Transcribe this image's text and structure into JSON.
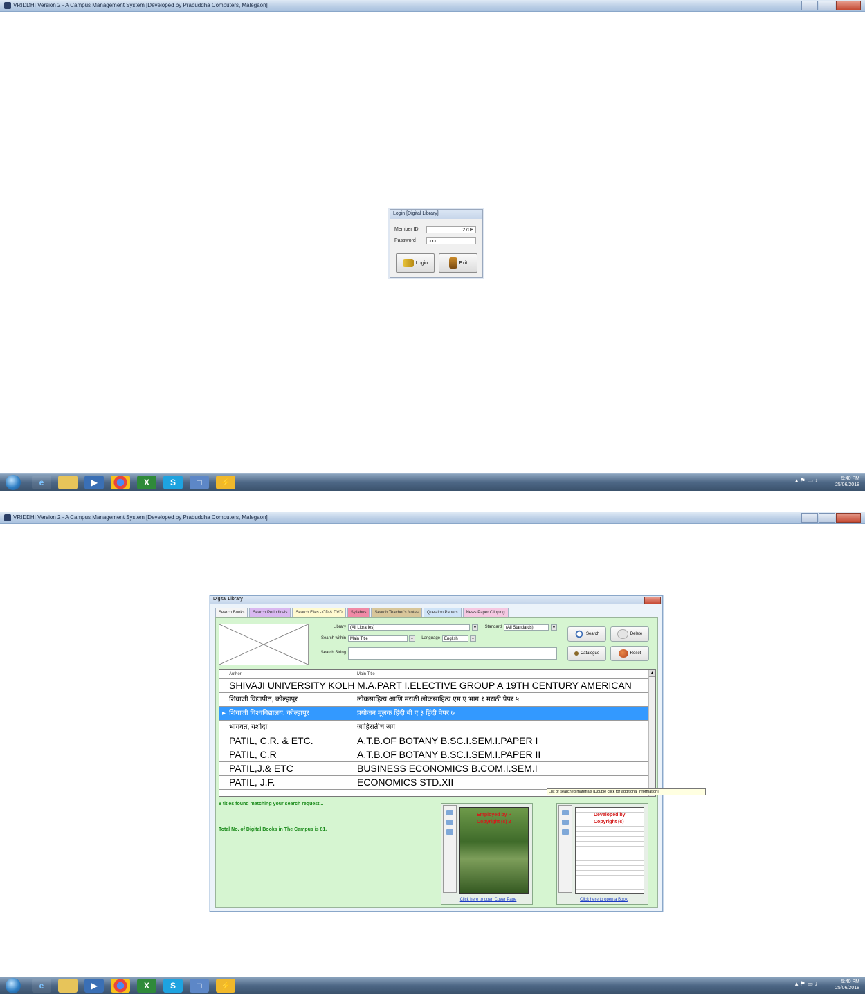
{
  "window_title": "VRIDDHI Version 2 - A Campus Management System [Developed by Prabuddha Computers, Malegaon]",
  "login": {
    "title": "Login [Digital Library]",
    "member_id_label": "Member ID",
    "member_id_value": "2708",
    "password_label": "Password",
    "password_value": "xxx",
    "login_button": "Login",
    "exit_button": "Exit"
  },
  "taskbar": {
    "time": "5:40 PM",
    "date": "25/06/2018"
  },
  "library": {
    "title": "Digital Library",
    "tabs": [
      {
        "label": "Search Books",
        "color": "#f4f4f4"
      },
      {
        "label": "Search Periodicals",
        "color": "#d9b8f0"
      },
      {
        "label": "Search Files - CD & DVD",
        "color": "#fffad0"
      },
      {
        "label": "Syllabus",
        "color": "#f08aa6"
      },
      {
        "label": "Search Teacher's Notes",
        "color": "#d8c69a"
      },
      {
        "label": "Question Papers",
        "color": "#cfe3f7"
      },
      {
        "label": "News Paper Clipping",
        "color": "#f5c8e2"
      }
    ],
    "library_label": "Library",
    "library_value": "(All Libraries)",
    "standard_label": "Standard",
    "standard_value": "(All Standards)",
    "search_within_label": "Search within",
    "search_within_value": "Main Title",
    "language_label": "Language",
    "language_value": "English",
    "search_string_label": "Search String",
    "buttons": {
      "search": "Search",
      "delete": "Delete",
      "catalogue": "Catalogue",
      "reset": "Reset"
    },
    "columns": [
      "Author",
      "Main Title"
    ],
    "rows": [
      {
        "author": "SHIVAJI UNIVERSITY KOLHAPUR",
        "title": "M.A.PART I.ELECTIVE GROUP A 19TH CENTURY AMERICAN",
        "style": "big"
      },
      {
        "author": "शिवाजी विद्यापीठ, कोल्हापूर",
        "title": "लोकसाहित्य आणि मराठी लोकसाहित्य एम ए भाग १ मराठी पेपर ५",
        "style": "dev"
      },
      {
        "author": "शिवाजी विश्वविद्यालय, कोल्हापूर",
        "title": "प्रयोजन मूलक हिंदी बी ए ३ हिंदी पेपर ७",
        "style": "dev",
        "selected": true
      },
      {
        "author": "भागवत, यशोदा",
        "title": "जाहिरातीचे जग",
        "style": "dev"
      },
      {
        "author": "PATIL, C.R. & ETC.",
        "title": "A.T.B.OF BOTANY B.SC.I.SEM.I.PAPER I",
        "style": "big"
      },
      {
        "author": "PATIL, C.R",
        "title": "A.T.B.OF BOTANY B.SC.I.SEM.I.PAPER II",
        "style": "big"
      },
      {
        "author": "PATIL,J.& ETC",
        "title": "BUSINESS ECONOMICS B.COM.I.SEM.I",
        "style": "big"
      },
      {
        "author": "PATIL, J.F.",
        "title": "ECONOMICS STD.XII",
        "style": "big"
      }
    ],
    "found_text": "8 titles found matching your search request...",
    "total_text": "Total No. of Digital Books in The Campus is 81.",
    "cover_watermark_1": "Employed by P",
    "cover_watermark_2": "Copyright (c) 2",
    "cover_link": "Click here to open Cover Page",
    "book_watermark_1": "Developed by",
    "book_watermark_2": "Copyright (c)",
    "book_link": "Click here to open a Book",
    "tooltip": "List of searched materials [Double click for additional information]"
  }
}
